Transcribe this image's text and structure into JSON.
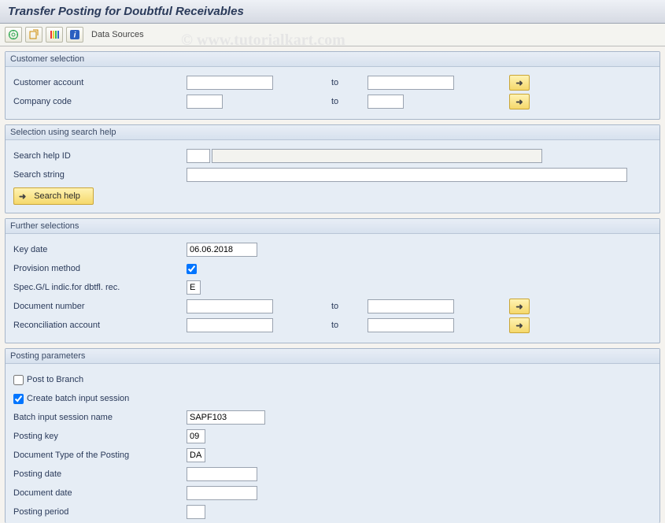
{
  "title": "Transfer Posting for Doubtful Receivables",
  "toolbar": {
    "data_sources": "Data Sources"
  },
  "watermark": "©  www.tutorialkart.com",
  "groups": {
    "customer_selection": {
      "title": "Customer selection",
      "customer_account": {
        "label": "Customer account",
        "from": "",
        "to_label": "to",
        "to": ""
      },
      "company_code": {
        "label": "Company code",
        "from": "",
        "to_label": "to",
        "to": ""
      }
    },
    "search_help": {
      "title": "Selection using search help",
      "id": {
        "label": "Search help ID",
        "value": ""
      },
      "string": {
        "label": "Search string",
        "value": ""
      },
      "button": "Search help"
    },
    "further": {
      "title": "Further selections",
      "key_date": {
        "label": "Key date",
        "value": "06.06.2018"
      },
      "provision_method": {
        "label": "Provision method",
        "checked": true
      },
      "spec_gl": {
        "label": "Spec.G/L indic.for dbtfl. rec.",
        "value": "E"
      },
      "doc_number": {
        "label": "Document number",
        "from": "",
        "to_label": "to",
        "to": ""
      },
      "recon_account": {
        "label": "Reconciliation account",
        "from": "",
        "to_label": "to",
        "to": ""
      }
    },
    "posting": {
      "title": "Posting parameters",
      "post_to_branch": {
        "label": "Post to Branch",
        "checked": false
      },
      "create_batch": {
        "label": "Create batch input session",
        "checked": true
      },
      "batch_name": {
        "label": "Batch input session name",
        "value": "SAPF103"
      },
      "posting_key": {
        "label": "Posting key",
        "value": "09"
      },
      "doc_type": {
        "label": "Document Type of the Posting",
        "value": "DA"
      },
      "posting_date": {
        "label": "Posting date",
        "value": ""
      },
      "doc_date": {
        "label": "Document date",
        "value": ""
      },
      "posting_period": {
        "label": "Posting period",
        "value": ""
      }
    }
  }
}
